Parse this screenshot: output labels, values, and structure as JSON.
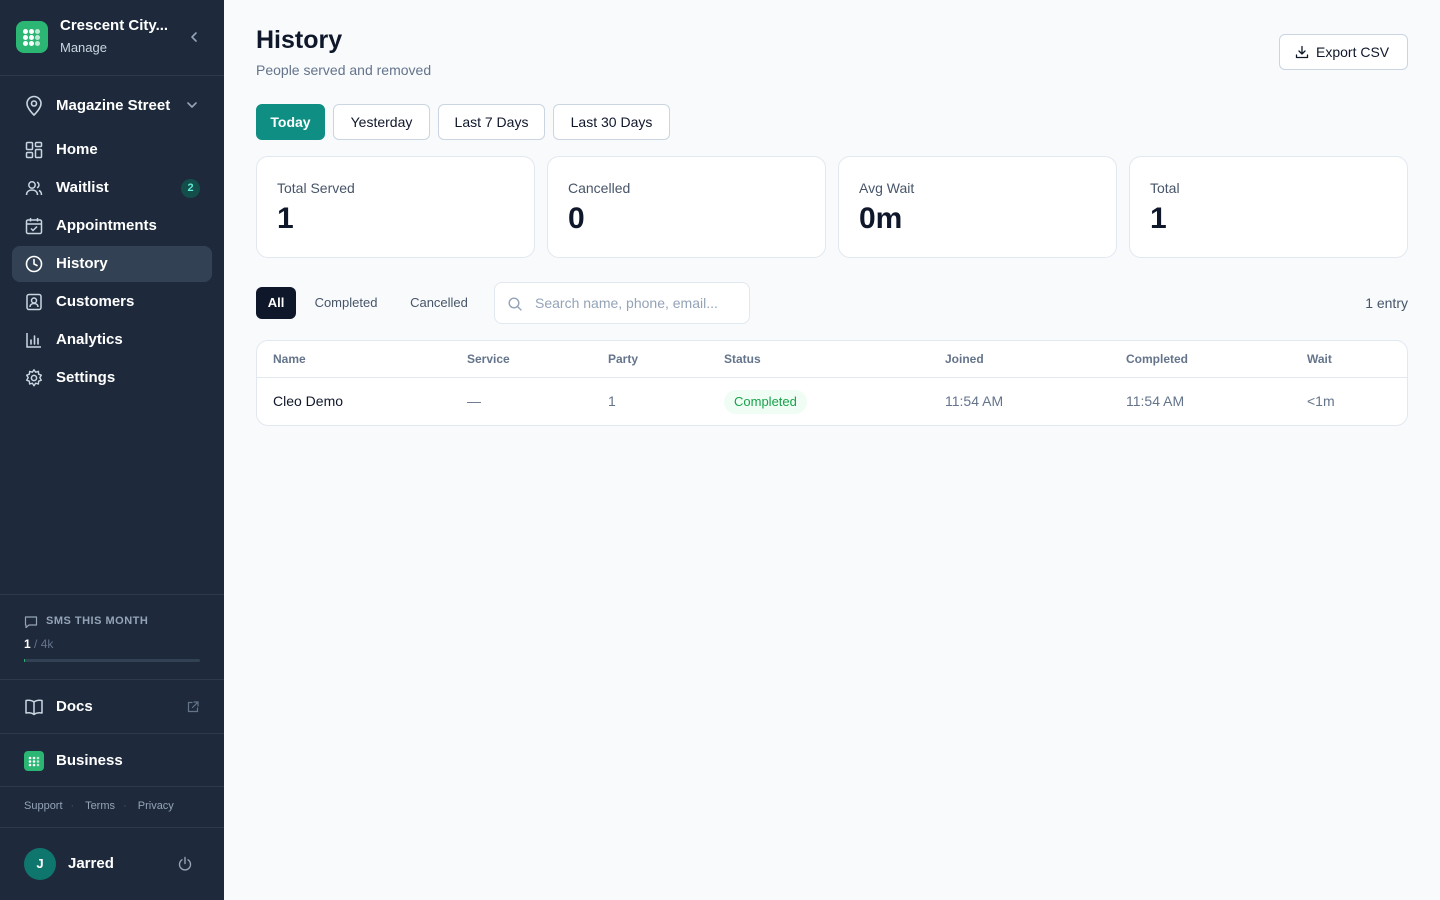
{
  "sidebar": {
    "brand": {
      "name": "Crescent City...",
      "sub": "Manage"
    },
    "location": "Magazine Street",
    "nav": [
      {
        "label": "Home",
        "icon": "grid-icon"
      },
      {
        "label": "Waitlist",
        "icon": "users-icon",
        "badge": "2"
      },
      {
        "label": "Appointments",
        "icon": "calendar-icon"
      },
      {
        "label": "History",
        "icon": "clock-icon",
        "active": true
      },
      {
        "label": "Customers",
        "icon": "contact-icon"
      },
      {
        "label": "Analytics",
        "icon": "bar-chart-icon"
      },
      {
        "label": "Settings",
        "icon": "gear-icon"
      }
    ],
    "sms": {
      "title": "SMS THIS MONTH",
      "used": "1",
      "limit": "/ 4k",
      "fraction": 0.00025
    },
    "docs": "Docs",
    "business": "Business",
    "footer_links": [
      "Support",
      "Terms",
      "Privacy"
    ],
    "user": {
      "initial": "J",
      "name": "Jarred"
    }
  },
  "header": {
    "title": "History",
    "subtitle": "People served and removed",
    "export_label": "Export CSV"
  },
  "ranges": [
    "Today",
    "Yesterday",
    "Last 7 Days",
    "Last 30 Days"
  ],
  "stats": [
    {
      "label": "Total Served",
      "value": "1"
    },
    {
      "label": "Cancelled",
      "value": "0"
    },
    {
      "label": "Avg Wait",
      "value": "0m"
    },
    {
      "label": "Total",
      "value": "1"
    }
  ],
  "filters": [
    "All",
    "Completed",
    "Cancelled"
  ],
  "search": {
    "placeholder": "Search name, phone, email..."
  },
  "entry_count": "1 entry",
  "table": {
    "columns": [
      "Name",
      "Service",
      "Party",
      "Status",
      "Joined",
      "Completed",
      "Wait"
    ],
    "rows": [
      {
        "name": "Cleo Demo",
        "service": "—",
        "party": "1",
        "status": "Completed",
        "joined": "11:54 AM",
        "completed": "11:54 AM",
        "wait": "<1m"
      }
    ]
  },
  "colors": {
    "accent": "#0f8f83",
    "sidebar_bg": "#1e2a3b",
    "brand": "#2bb673",
    "status_completed": "#16a34a"
  }
}
